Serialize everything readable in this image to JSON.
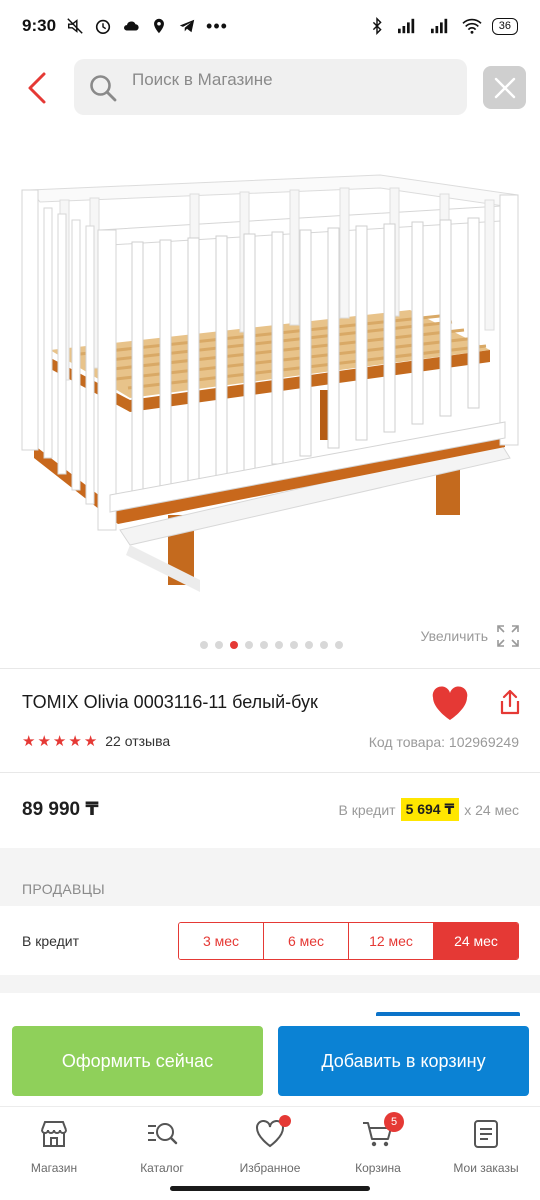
{
  "status_bar": {
    "time": "9:30",
    "battery": "36",
    "left_icons": [
      "mute-icon",
      "alarm-icon",
      "cloud-icon",
      "location-icon",
      "telegram-icon",
      "more-icon"
    ],
    "right_icons": [
      "bluetooth-icon",
      "signal-icon",
      "signal-icon",
      "wifi-icon",
      "battery-icon"
    ]
  },
  "header": {
    "back_icon": "chevron-left-icon",
    "search_placeholder": "Поиск в Магазине",
    "close_icon": "close-icon"
  },
  "gallery": {
    "zoom_label": "Увеличить",
    "dot_count": 10,
    "active_dot": 2
  },
  "product": {
    "title": "TOMIX Olivia 0003116-11 белый-бук",
    "rating_stars": 5,
    "reviews": "22 отзыва",
    "sku": "Код товара: 102969249",
    "price": "89 990 ₸",
    "credit_prefix": "В кредит",
    "credit_amount": "5 694 ₸",
    "credit_suffix": "х 24 мес"
  },
  "sellers": {
    "section_label": "ПРОДАВЦЫ",
    "credit_label": "В кредит",
    "terms": [
      "3 мес",
      "6 мес",
      "12 мес",
      "24 мес"
    ],
    "active_term": "24 мес"
  },
  "actions": {
    "buy_now": "Оформить сейчас",
    "add_to_cart": "Добавить в корзину"
  },
  "bottom_nav": {
    "items": [
      {
        "label": "Магазин",
        "icon": "store-icon"
      },
      {
        "label": "Каталог",
        "icon": "catalog-search-icon"
      },
      {
        "label": "Избранное",
        "icon": "heart-icon"
      },
      {
        "label": "Корзина",
        "icon": "cart-icon",
        "badge": "5"
      },
      {
        "label": "Мои заказы",
        "icon": "orders-icon"
      }
    ]
  },
  "colors": {
    "accent_red": "#e53935",
    "buy_now_green": "#8fd05a",
    "cart_blue": "#0b82d4",
    "credit_yellow": "#ffe600"
  }
}
